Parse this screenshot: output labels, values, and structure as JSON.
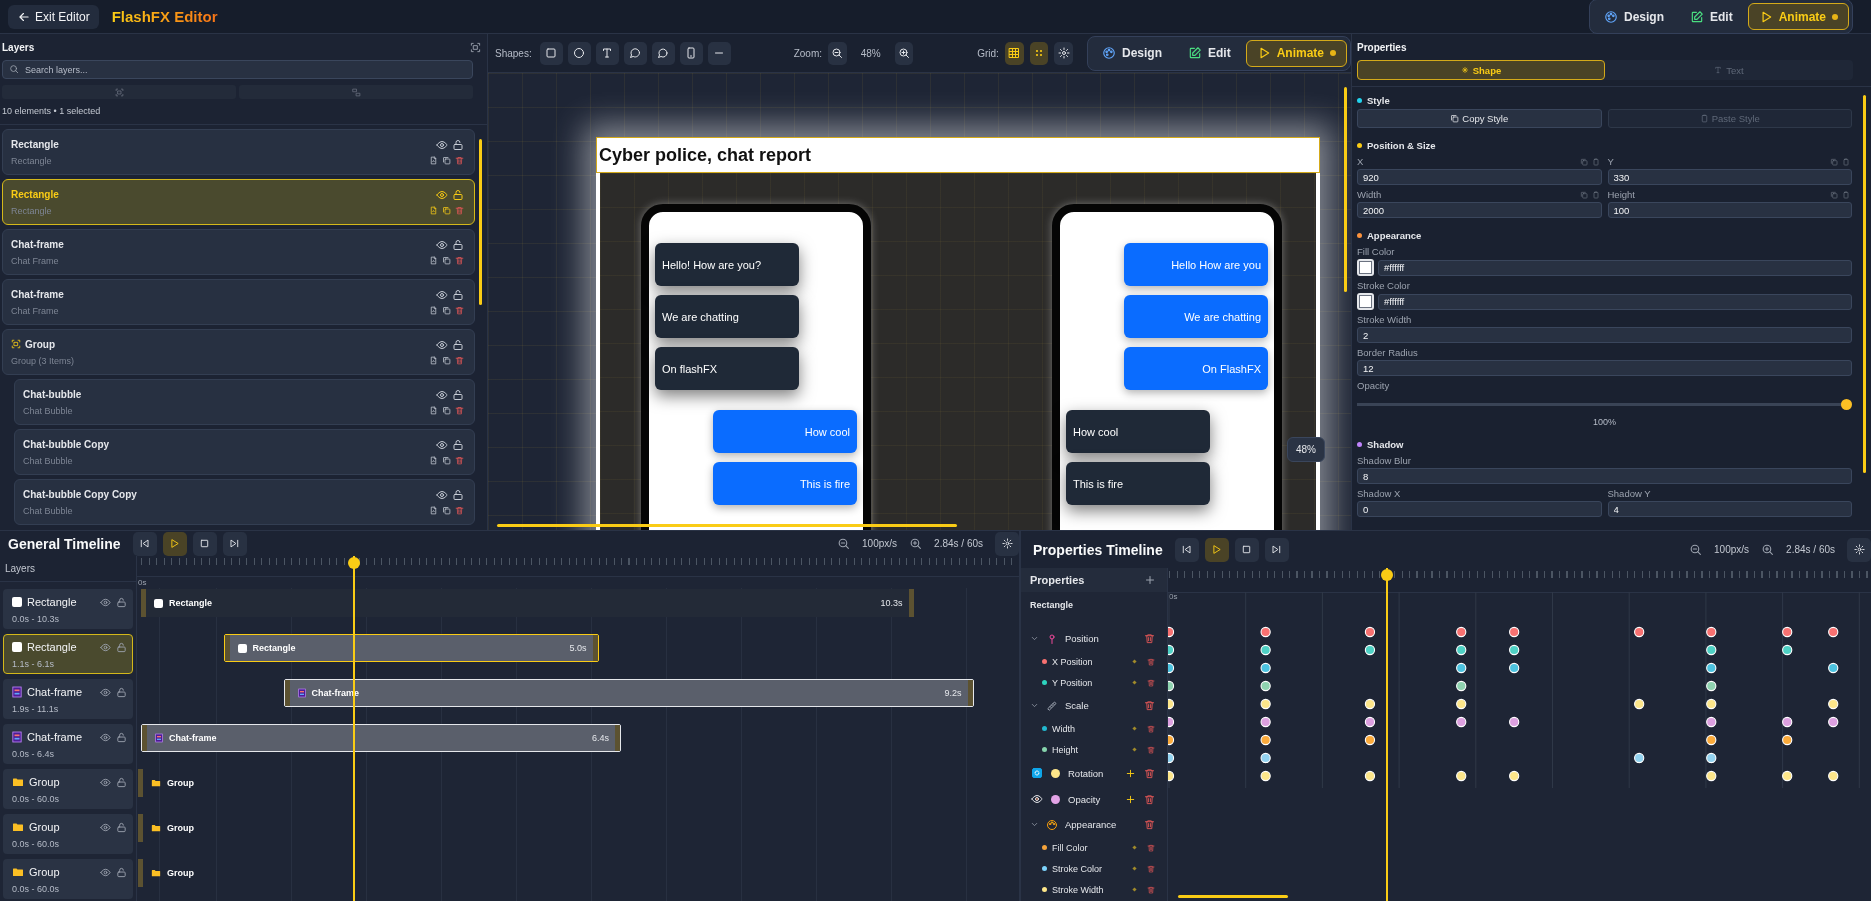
{
  "topbar": {
    "exit_label": "Exit Editor",
    "title": "FlashFX Editor",
    "modes": [
      {
        "label": "Design",
        "selected": false
      },
      {
        "label": "Edit",
        "selected": false
      },
      {
        "label": "Animate",
        "selected": true
      }
    ]
  },
  "layers_panel": {
    "title": "Layers",
    "search": {
      "placeholder": "Search layers..."
    },
    "summary": "10 elements • 1 selected",
    "items": [
      {
        "name": "Rectangle",
        "type_label": "Rectangle",
        "kind": "layer",
        "selected": false
      },
      {
        "name": "Rectangle",
        "type_label": "Rectangle",
        "kind": "layer",
        "selected": true
      },
      {
        "name": "Chat-frame",
        "type_label": "Chat Frame",
        "kind": "layer",
        "selected": false
      },
      {
        "name": "Chat-frame",
        "type_label": "Chat Frame",
        "kind": "layer",
        "selected": false
      },
      {
        "name": "Group",
        "type_label": "Group (3 Items)",
        "kind": "group",
        "selected": false,
        "children": [
          {
            "name": "Chat-bubble",
            "type_label": "Chat Bubble",
            "selected": false
          },
          {
            "name": "Chat-bubble Copy",
            "type_label": "Chat Bubble",
            "selected": false
          },
          {
            "name": "Chat-bubble Copy Copy",
            "type_label": "Chat Bubble",
            "selected": false
          }
        ]
      }
    ]
  },
  "canvas": {
    "toolbar": {
      "shapes_label": "Shapes:",
      "zoom_label": "Zoom:",
      "zoom": "48%",
      "grid_label": "Grid:",
      "grid_lines": true,
      "snap": true,
      "modes": [
        {
          "label": "Design",
          "selected": false
        },
        {
          "label": "Edit",
          "selected": false
        },
        {
          "label": "Animate",
          "selected": true
        }
      ]
    },
    "artboard": {
      "title": "Cyber police, chat report",
      "phones": [
        {
          "bubbles": [
            {
              "text": "Hello! How are you?",
              "kind": "received"
            },
            {
              "text": "We are chatting",
              "kind": "received"
            },
            {
              "text": "On flashFX",
              "kind": "received"
            },
            {
              "text": "How cool",
              "kind": "sent"
            },
            {
              "text": "This is fire",
              "kind": "sent"
            }
          ]
        },
        {
          "bubbles": [
            {
              "text": "Hello How are you",
              "kind": "sent"
            },
            {
              "text": "We are chatting",
              "kind": "sent"
            },
            {
              "text": "On FlashFX",
              "kind": "sent"
            },
            {
              "text": "How cool",
              "kind": "received"
            },
            {
              "text": "This is fire",
              "kind": "received"
            }
          ]
        }
      ]
    },
    "zoom_badge": "48%"
  },
  "properties": {
    "title": "Properties",
    "tabs": [
      {
        "label": "Shape",
        "selected": true
      },
      {
        "label": "Text",
        "selected": false
      }
    ],
    "sections": [
      {
        "title": "Style",
        "color": "#22d3ee",
        "buttons": [
          {
            "label": "Copy Style",
            "disabled": false
          },
          {
            "label": "Paste Style",
            "disabled": true
          }
        ]
      },
      {
        "title": "Position & Size",
        "color": "#facc15",
        "fields": [
          {
            "kind": "half",
            "label": "X",
            "value": "920",
            "tools": true
          },
          {
            "kind": "half",
            "label": "Y",
            "value": "330",
            "tools": true
          },
          {
            "kind": "half",
            "label": "Width",
            "value": "2000",
            "tools": true
          },
          {
            "kind": "half",
            "label": "Height",
            "value": "100",
            "tools": true
          }
        ]
      },
      {
        "title": "Appearance",
        "color": "#fb923c",
        "fields": [
          {
            "kind": "color",
            "label": "Fill Color",
            "value": "#ffffff"
          },
          {
            "kind": "color",
            "label": "Stroke Color",
            "value": "#ffffff"
          },
          {
            "kind": "full",
            "label": "Stroke Width",
            "value": "2"
          },
          {
            "kind": "full",
            "label": "Border Radius",
            "value": "12"
          },
          {
            "kind": "slider",
            "label": "Opacity",
            "level": 1,
            "reading": "100%"
          }
        ]
      },
      {
        "title": "Shadow",
        "color": "#c084fc",
        "fields": [
          {
            "kind": "full",
            "label": "Shadow Blur",
            "value": "8"
          },
          {
            "kind": "half",
            "label": "Shadow X",
            "value": "0",
            "tools": false
          },
          {
            "kind": "half",
            "label": "Shadow Y",
            "value": "4",
            "tools": false
          }
        ]
      }
    ]
  },
  "general_timeline": {
    "title": "General Timeline",
    "playing": true,
    "zoom": "100px/s",
    "time": "2.84s / 60s",
    "layers_label": "Layers",
    "ruler_start": "0s",
    "tracks": [
      {
        "name": "Rectangle",
        "range": "0.0s - 10.3s",
        "kind": "shape",
        "selected": false,
        "bar": {
          "kind": "dim",
          "label": "Rectangle",
          "duration": "10.3s"
        }
      },
      {
        "name": "Rectangle",
        "range": "1.1s - 6.1s",
        "kind": "shape",
        "selected": true,
        "bar": {
          "kind": "light",
          "label": "Rectangle",
          "duration": "5.0s"
        }
      },
      {
        "name": "Chat-frame",
        "range": "1.9s - 11.1s",
        "kind": "frame",
        "selected": false,
        "bar": {
          "kind": "light",
          "label": "Chat-frame",
          "duration": "9.2s"
        }
      },
      {
        "name": "Chat-frame",
        "range": "0.0s - 6.4s",
        "kind": "frame",
        "selected": false,
        "bar": {
          "kind": "light",
          "label": "Chat-frame",
          "duration": "6.4s"
        }
      },
      {
        "name": "Group",
        "range": "0.0s - 60.0s",
        "kind": "group",
        "selected": false,
        "bar": {
          "kind": "stub",
          "label": "Group"
        }
      },
      {
        "name": "Group",
        "range": "0.0s - 60.0s",
        "kind": "group",
        "selected": false,
        "bar": {
          "kind": "stub",
          "label": "Group"
        }
      },
      {
        "name": "Group",
        "range": "0.0s - 60.0s",
        "kind": "group",
        "selected": false,
        "bar": {
          "kind": "stub",
          "label": "Group"
        }
      }
    ]
  },
  "properties_timeline": {
    "title": "Properties Timeline",
    "playing": true,
    "zoom": "100px/s",
    "time": "2.84s / 60s",
    "list_title": "Properties",
    "target": "Rectangle",
    "ruler_start": "0s",
    "properties": [
      {
        "label": "Position",
        "kind": "group",
        "expanded": true,
        "children": [
          {
            "label": "X Position",
            "color": "#f87171"
          },
          {
            "label": "Y Position",
            "color": "#2dd4bf"
          }
        ]
      },
      {
        "label": "Scale",
        "kind": "group",
        "expanded": true,
        "children": [
          {
            "label": "Width",
            "color": "#22b8cf"
          },
          {
            "label": "Height",
            "color": "#86d3ac"
          }
        ]
      },
      {
        "label": "Rotation",
        "kind": "single",
        "color": "#fde68a"
      },
      {
        "label": "Opacity",
        "kind": "single",
        "color": "#e2a3e6"
      },
      {
        "label": "Appearance",
        "kind": "group",
        "expanded": true,
        "children": [
          {
            "label": "Fill Color",
            "color": "#f5a33b"
          },
          {
            "label": "Stroke Color",
            "color": "#7dd3fc"
          },
          {
            "label": "Stroke Width",
            "color": "#fde68a"
          }
        ]
      }
    ]
  }
}
